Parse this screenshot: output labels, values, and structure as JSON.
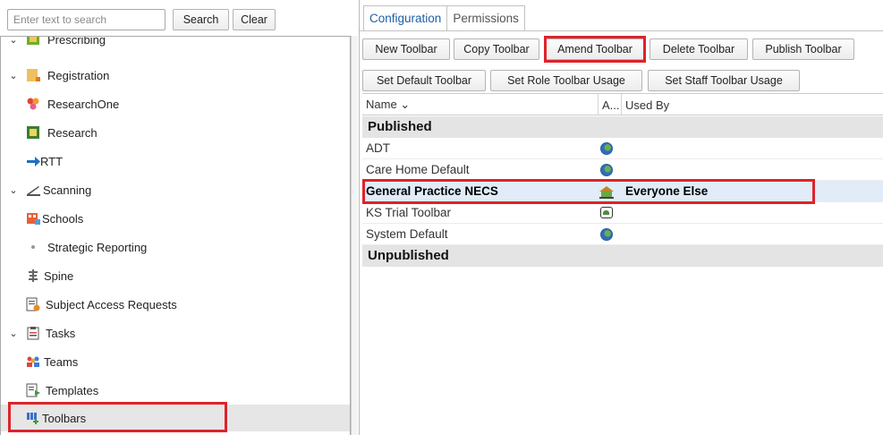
{
  "search": {
    "placeholder": "Enter text to search",
    "search_label": "Search",
    "clear_label": "Clear"
  },
  "tree": {
    "items": [
      {
        "label": "Prescribing",
        "expander": "⌄",
        "icon": "prescribing-icon"
      },
      {
        "label": "Registration",
        "expander": "⌄",
        "icon": "folder-icon"
      },
      {
        "label": "ResearchOne",
        "expander": "",
        "icon": "researchone-icon"
      },
      {
        "label": "Research",
        "expander": "",
        "icon": "research-book-icon"
      },
      {
        "label": "RTT",
        "expander": "",
        "icon": "arrow-right-icon"
      },
      {
        "label": "Scanning",
        "expander": "⌄",
        "icon": "scanner-icon"
      },
      {
        "label": "Schools",
        "expander": "",
        "icon": "schools-icon"
      },
      {
        "label": "Strategic Reporting",
        "expander": "",
        "icon": "dot-icon"
      },
      {
        "label": "Spine",
        "expander": "",
        "icon": "spine-icon"
      },
      {
        "label": "Subject Access Requests",
        "expander": "",
        "icon": "document-icon"
      },
      {
        "label": "Tasks",
        "expander": "⌄",
        "icon": "clipboard-icon"
      },
      {
        "label": "Teams",
        "expander": "",
        "icon": "teams-icon"
      },
      {
        "label": "Templates",
        "expander": "",
        "icon": "templates-icon"
      },
      {
        "label": "Toolbars",
        "expander": "",
        "icon": "toolbars-icon"
      }
    ]
  },
  "tabs": {
    "configuration": "Configuration",
    "permissions": "Permissions"
  },
  "toolbar": {
    "new": "New Toolbar",
    "copy": "Copy Toolbar",
    "amend": "Amend Toolbar",
    "delete": "Delete Toolbar",
    "publish": "Publish Toolbar",
    "set_default": "Set Default Toolbar",
    "set_role": "Set Role Toolbar Usage",
    "set_staff": "Set Staff Toolbar Usage"
  },
  "grid": {
    "columns": {
      "name": "Name ⌄",
      "a": "A...",
      "used_by": "Used By"
    },
    "groups": {
      "published": "Published",
      "unpublished": "Unpublished"
    },
    "rows": [
      {
        "name": "ADT",
        "icon": "globe-icon",
        "used_by": ""
      },
      {
        "name": "Care Home Default",
        "icon": "globe-icon",
        "used_by": ""
      },
      {
        "name": "General Practice NECS",
        "icon": "practice-icon",
        "used_by": "Everyone Else"
      },
      {
        "name": "KS Trial Toolbar",
        "icon": "house-box-icon",
        "used_by": ""
      },
      {
        "name": "System Default",
        "icon": "globe-icon",
        "used_by": ""
      }
    ]
  },
  "colors": {
    "highlight": "#e0222a",
    "tab_active": "#1d5fa8",
    "selected_row": "#e1ecf8",
    "group_bg": "#e4e4e4"
  }
}
